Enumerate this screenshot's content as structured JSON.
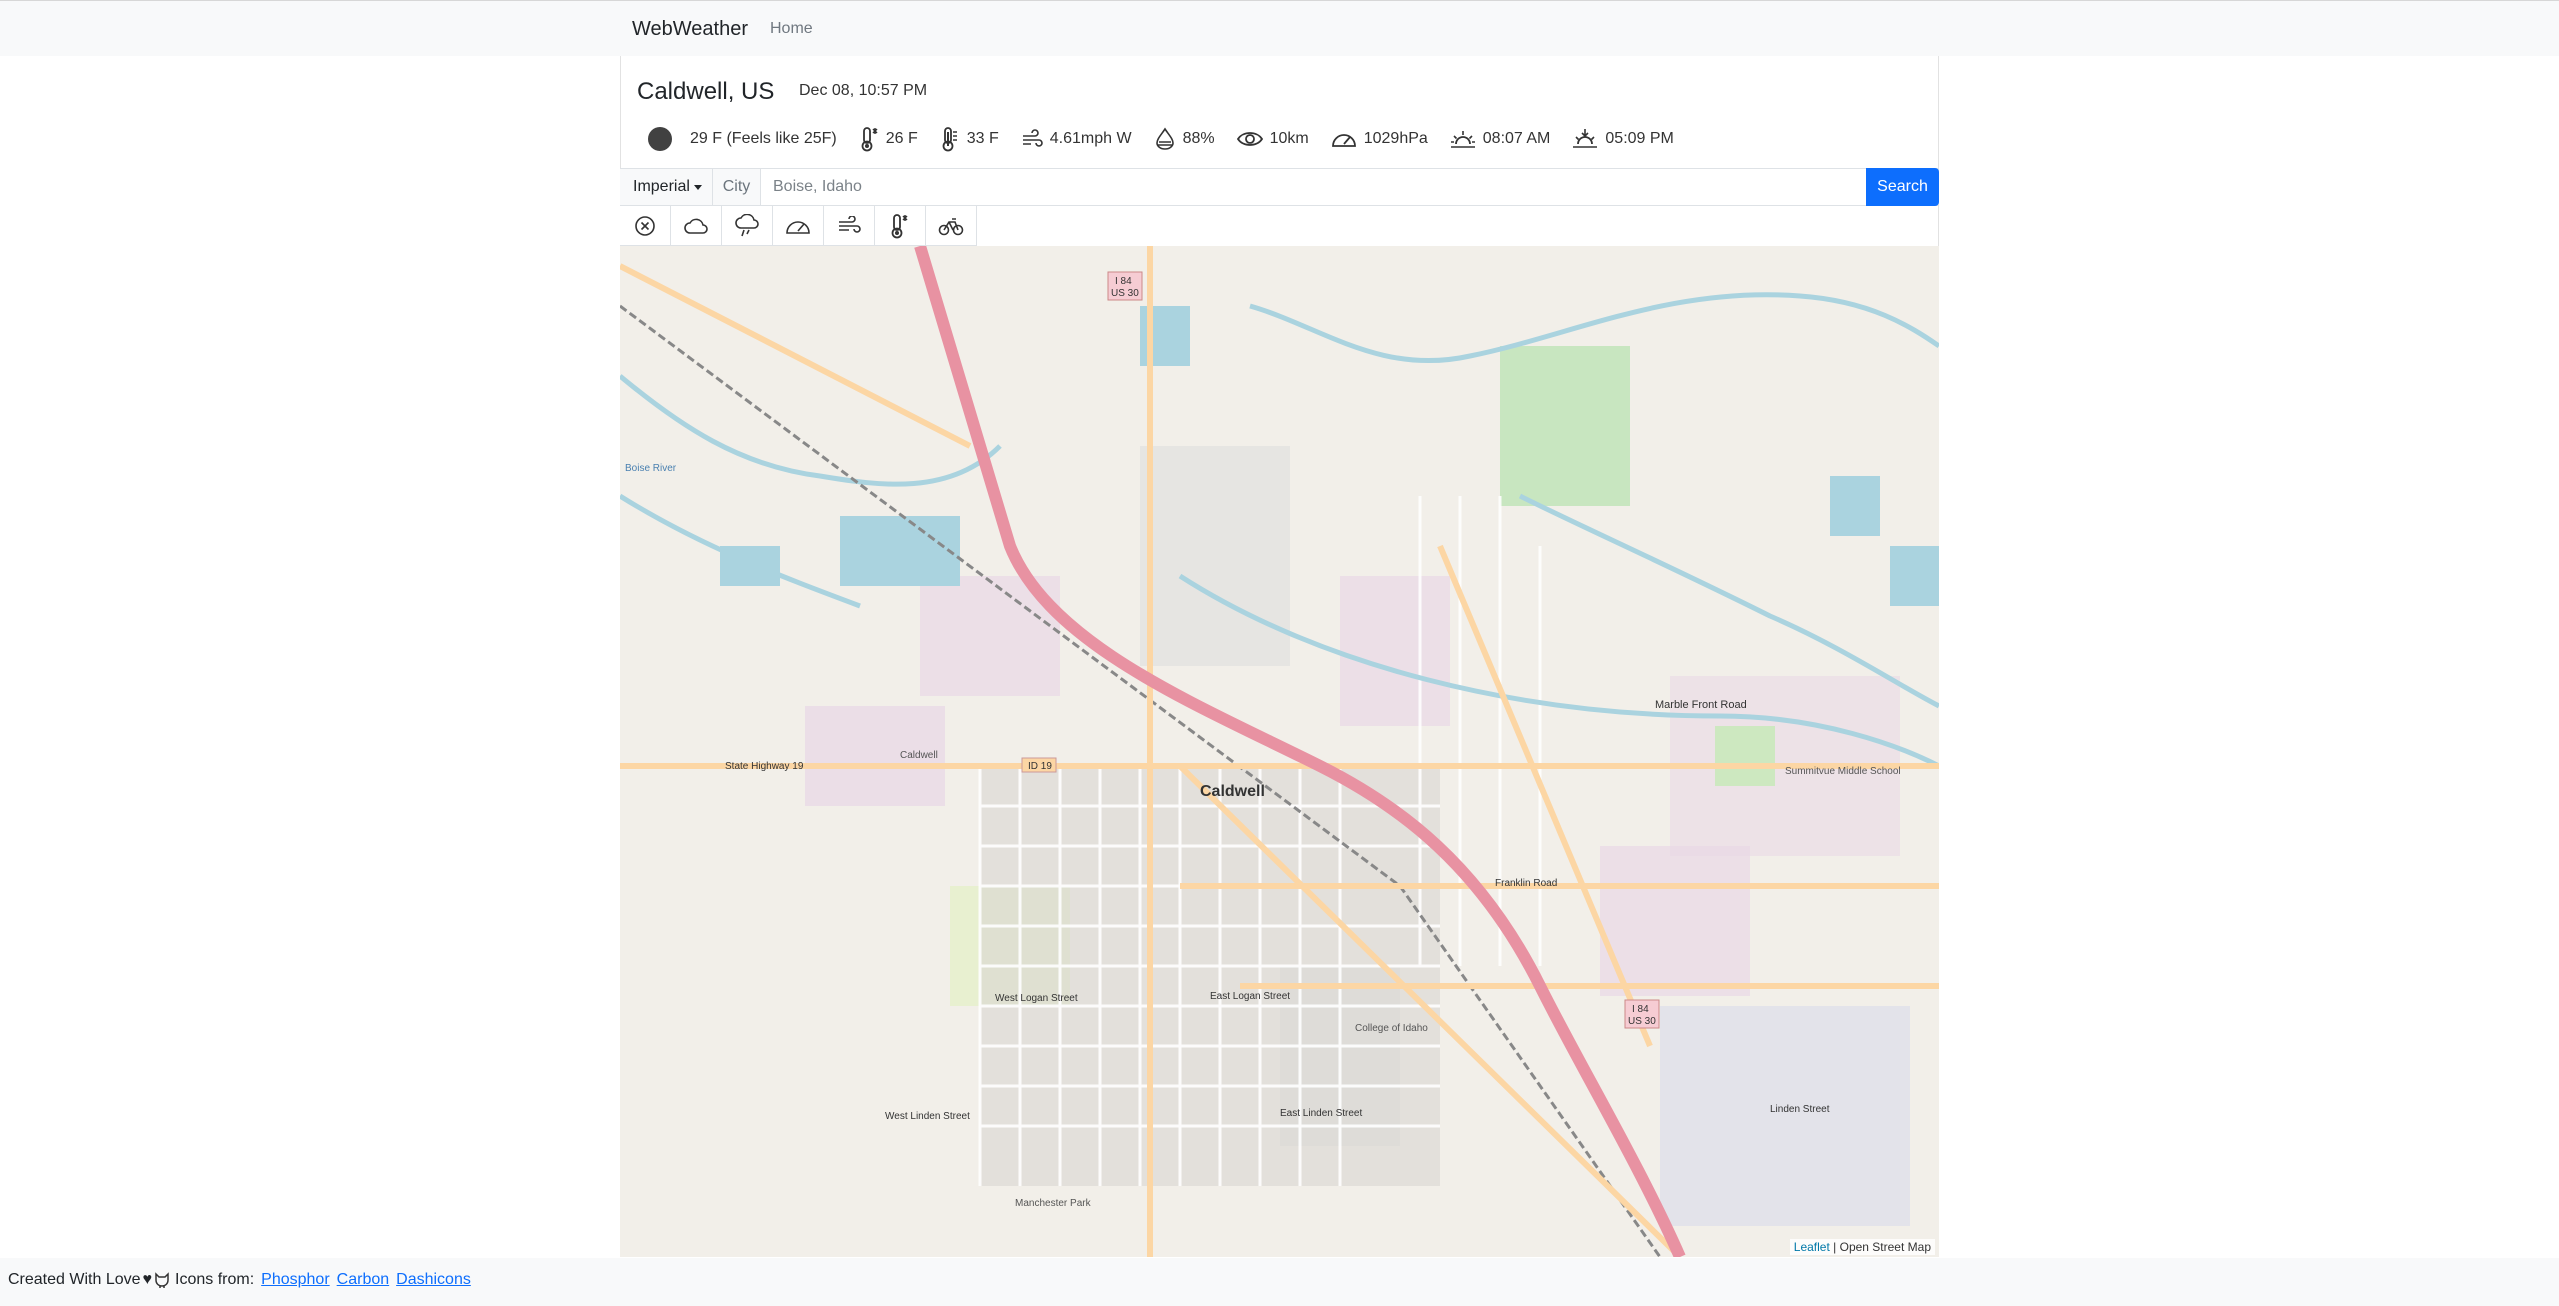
{
  "navbar": {
    "brand": "WebWeather",
    "home": "Home"
  },
  "location": {
    "name": "Caldwell, US",
    "datetime": "Dec 08, 10:57 PM"
  },
  "stats": {
    "temperature": "29 F (Feels like 25F)",
    "temp_min": "26 F",
    "temp_max": "33 F",
    "wind": "4.61mph W",
    "humidity": "88%",
    "visibility": "10km",
    "pressure": "1029hPa",
    "sunrise": "08:07 AM",
    "sunset": "05:09 PM"
  },
  "search": {
    "unit": "Imperial",
    "city_label": "City",
    "placeholder": "Boise, Idaho",
    "button": "Search"
  },
  "layers": [
    "close-icon",
    "cloud-icon",
    "precipitation-icon",
    "pressure-icon",
    "wind-icon",
    "temperature-icon",
    "bike-icon"
  ],
  "map": {
    "labels": {
      "city": "Caldwell",
      "marble_front": "Marble Front Road",
      "state_hwy": "State Highway 19",
      "id19": "ID 19",
      "i84_top": "I 84",
      "us30_top": "US 30",
      "i84_bottom": "I 84",
      "us30_bottom": "US 30",
      "west_logan": "West Logan Street",
      "east_logan": "East Logan Street",
      "west_linden": "West Linden Street",
      "east_linden": "East Linden Street",
      "linden": "Linden Street",
      "franklin": "Franklin Road",
      "college": "College of Idaho",
      "manchester": "Manchester Park",
      "summitvue": "Summitvue Middle School",
      "boise_river": "Boise River",
      "caldwell_small": "Caldwell"
    },
    "attribution_leaflet": "Leaflet",
    "attribution_osm": "| Open Street Map"
  },
  "footer": {
    "created": "Created With Love",
    "icons_from": "Icons from:",
    "links": [
      "Phosphor",
      "Carbon",
      "Dashicons"
    ]
  },
  "colors": {
    "primary": "#0d6efd",
    "motorway": "#e892a2",
    "primary_road": "#fcd6a4",
    "water": "#aad3df"
  }
}
